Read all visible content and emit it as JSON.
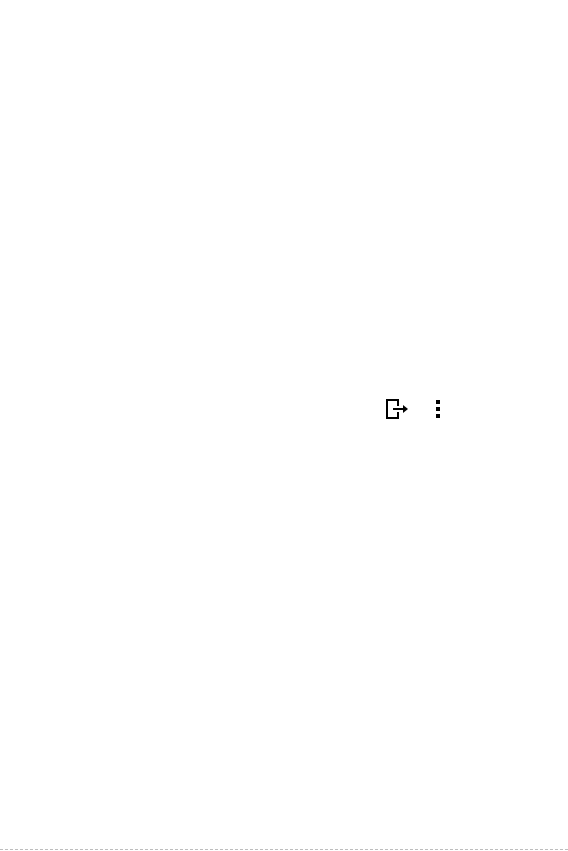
{
  "screen": {
    "background": "#ffffff"
  },
  "action_bar": {
    "items": [
      {
        "icon": "cast-to-device-icon",
        "color": "#000000"
      },
      {
        "icon": "more-vertical-icon",
        "color": "#000000"
      }
    ]
  }
}
